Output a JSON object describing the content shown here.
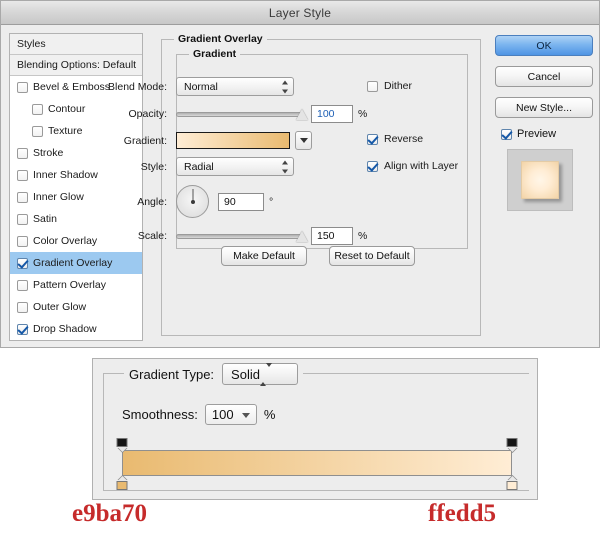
{
  "window": {
    "title": "Layer Style"
  },
  "styles_panel": {
    "header": "Styles",
    "blending_options": "Blending Options: Default",
    "items": [
      {
        "label": "Bevel & Emboss",
        "checked": false,
        "indent": false,
        "selected": false
      },
      {
        "label": "Contour",
        "checked": false,
        "indent": true,
        "selected": false
      },
      {
        "label": "Texture",
        "checked": false,
        "indent": true,
        "selected": false
      },
      {
        "label": "Stroke",
        "checked": false,
        "indent": false,
        "selected": false
      },
      {
        "label": "Inner Shadow",
        "checked": false,
        "indent": false,
        "selected": false
      },
      {
        "label": "Inner Glow",
        "checked": false,
        "indent": false,
        "selected": false
      },
      {
        "label": "Satin",
        "checked": false,
        "indent": false,
        "selected": false
      },
      {
        "label": "Color Overlay",
        "checked": false,
        "indent": false,
        "selected": false
      },
      {
        "label": "Gradient Overlay",
        "checked": true,
        "indent": false,
        "selected": true
      },
      {
        "label": "Pattern Overlay",
        "checked": false,
        "indent": false,
        "selected": false
      },
      {
        "label": "Outer Glow",
        "checked": false,
        "indent": false,
        "selected": false
      },
      {
        "label": "Drop Shadow",
        "checked": true,
        "indent": false,
        "selected": false
      }
    ]
  },
  "gradient_overlay": {
    "group_title": "Gradient Overlay",
    "inner_group_title": "Gradient",
    "blend_mode": {
      "label": "Blend Mode:",
      "value": "Normal"
    },
    "dither": {
      "label": "Dither",
      "checked": false
    },
    "opacity": {
      "label": "Opacity:",
      "value": "100",
      "unit": "%",
      "percent": 100
    },
    "gradient": {
      "label": "Gradient:"
    },
    "reverse": {
      "label": "Reverse",
      "checked": true
    },
    "style": {
      "label": "Style:",
      "value": "Radial"
    },
    "align_with_layer": {
      "label": "Align with Layer",
      "checked": true
    },
    "angle": {
      "label": "Angle:",
      "value": "90",
      "unit": "°",
      "degrees": 90
    },
    "scale": {
      "label": "Scale:",
      "value": "150",
      "unit": "%",
      "percent": 100
    },
    "make_default": "Make Default",
    "reset_to_default": "Reset to Default"
  },
  "actions": {
    "ok": "OK",
    "cancel": "Cancel",
    "new_style": "New Style...",
    "preview": {
      "label": "Preview",
      "checked": true
    }
  },
  "gradient_editor": {
    "gradient_type": {
      "label": "Gradient Type:",
      "value": "Solid"
    },
    "smoothness": {
      "label": "Smoothness:",
      "value": "100",
      "unit": "%"
    },
    "opacity_stops": [
      {
        "position": 0,
        "opacity": 100
      },
      {
        "position": 100,
        "opacity": 100
      }
    ],
    "color_stops": [
      {
        "position": 0,
        "color": "#e9ba70"
      },
      {
        "position": 100,
        "color": "#ffedd5"
      }
    ]
  },
  "annotations": {
    "left_hex": "e9ba70",
    "right_hex": "ffedd5",
    "hex_color": "#c62b2b"
  },
  "colors": {
    "stop_left": "#e9ba70",
    "stop_right": "#ffedd5",
    "selection_blue": "#9cc9f0",
    "dialog_bg": "#ededed"
  }
}
